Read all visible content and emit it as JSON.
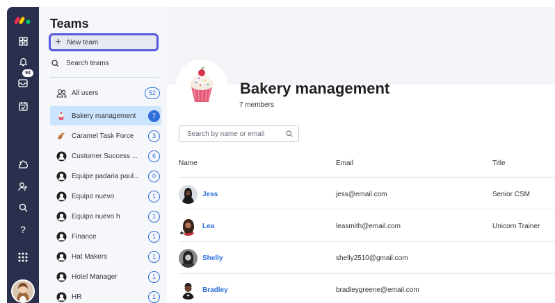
{
  "rail": {
    "items": [
      {
        "icon": "apps-icon"
      },
      {
        "icon": "bell-icon"
      },
      {
        "icon": "inbox-icon",
        "badge": "94"
      },
      {
        "icon": "calendar-check-icon"
      },
      {
        "icon": "puzzle-icon"
      },
      {
        "icon": "add-user-icon"
      },
      {
        "icon": "search-icon"
      },
      {
        "icon": "help-icon"
      },
      {
        "icon": "grid-dots-icon"
      }
    ]
  },
  "panel": {
    "title": "Teams",
    "new_team_label": "New team",
    "search_label": "Search teams",
    "all_users": {
      "label": "All users",
      "count": "52"
    },
    "teams": [
      {
        "name": "Bakery management",
        "count": "7",
        "active": true
      },
      {
        "name": "Caramel Task Force",
        "count": "3"
      },
      {
        "name": "Customer Success ...",
        "count": "6"
      },
      {
        "name": "Equipe padaria paul...",
        "count": "0"
      },
      {
        "name": "Equipo nuevo",
        "count": "1"
      },
      {
        "name": "Equipo nuevo h",
        "count": "1"
      },
      {
        "name": "Finance",
        "count": "1"
      },
      {
        "name": "Hat Makers",
        "count": "1"
      },
      {
        "name": "Hotel Manager",
        "count": "1"
      },
      {
        "name": "HR",
        "count": "1"
      }
    ]
  },
  "main": {
    "team_title": "Bakery management",
    "members_count": "7 members",
    "search_placeholder": "Search by name or email",
    "columns": {
      "name": "Name",
      "email": "Email",
      "title": "Title"
    },
    "members": [
      {
        "name": "Jess",
        "email": "jess@email.com",
        "title": "Senior CSM"
      },
      {
        "name": "Lea",
        "email": "leasmith@email.com",
        "title": "Unicorn Trainer"
      },
      {
        "name": "Shelly",
        "email": "shelly2510@gmail.com",
        "title": ""
      },
      {
        "name": "Bradley",
        "email": "bradleygreene@email.com",
        "title": ""
      }
    ]
  },
  "colors": {
    "rail": "#292f4c",
    "accent": "#5559df",
    "link": "#2f6fd9",
    "active_row": "#cce5ff"
  }
}
